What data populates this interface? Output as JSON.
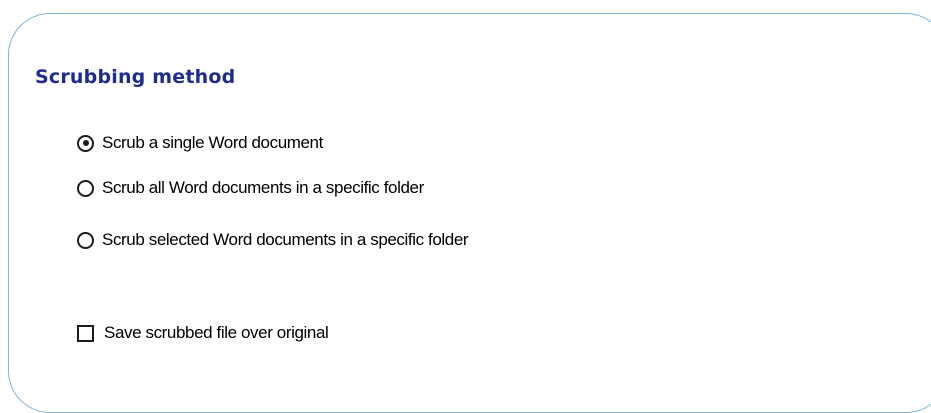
{
  "section": {
    "title": "Scrubbing method"
  },
  "scrub_method": {
    "selected_index": 0,
    "options": [
      {
        "label": "Scrub a single Word document",
        "selected": true
      },
      {
        "label": "Scrub all Word documents in a specific folder",
        "selected": false
      },
      {
        "label": "Scrub selected Word documents in a specific folder",
        "selected": false
      }
    ]
  },
  "save_over_original": {
    "label": "Save scrubbed file over original",
    "checked": false
  },
  "colors": {
    "title": "#1e2b8f",
    "panel_border": "#7fb6d6",
    "control": "#1c1c1c"
  }
}
